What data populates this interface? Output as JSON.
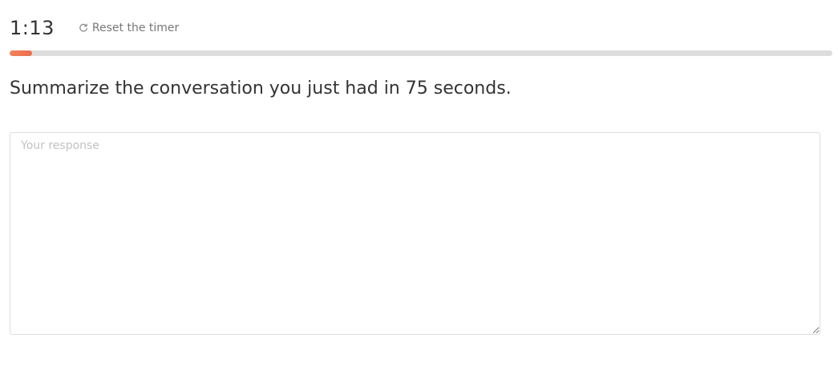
{
  "timer": {
    "value": "1:13",
    "reset_label": "Reset the timer",
    "reset_icon": "refresh-icon",
    "progress_fraction": 0.027,
    "progress_color": "#ee6d4c"
  },
  "question": {
    "prompt": "Summarize the conversation you just had in 75 seconds."
  },
  "response": {
    "placeholder": "Your response",
    "value": ""
  }
}
